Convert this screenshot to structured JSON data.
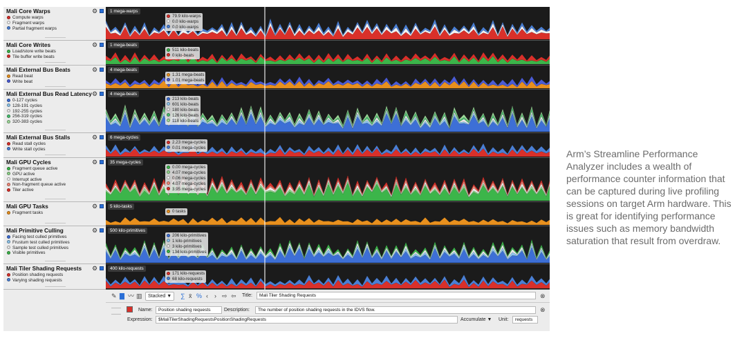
{
  "caption": "Arm’s Streamline Performance Analyzer includes a wealth of performance counter information that can be captured during live profiling sessions on target Arm hardware. This is great for identifying performance issues such as memory bandwidth saturation that result from overdraw.",
  "tracks": [
    {
      "title": "Mali Core Warps",
      "scale": "1 mega-warps",
      "legend": [
        {
          "label": "Compute warps",
          "color": "#d9302a"
        },
        {
          "label": "Fragment warps",
          "color": "#f2f2f2"
        },
        {
          "label": "Partial fragment warps",
          "color": "#4a7fd4"
        }
      ],
      "tooltip": [
        {
          "value": "79.9 kilo-warps",
          "color": "#d9302a"
        },
        {
          "value": "0.0 kilo-warps",
          "color": "#f2f2f2"
        },
        {
          "value": "0.0 kilo-warps",
          "color": "#4a7fd4"
        }
      ]
    },
    {
      "title": "Mali Core Writes",
      "scale": "1 mega-beats",
      "legend": [
        {
          "label": "Load/store write beats",
          "color": "#3cb54a"
        },
        {
          "label": "Tile buffer write beats",
          "color": "#d9302a"
        }
      ],
      "tooltip": [
        {
          "value": "511 kilo-beats",
          "color": "#3cb54a"
        },
        {
          "value": "0 kilo-beats",
          "color": "#d9302a"
        }
      ]
    },
    {
      "title": "Mali External Bus Beats",
      "scale": "4 mega-beats",
      "legend": [
        {
          "label": "Read beat",
          "color": "#e8901e"
        },
        {
          "label": "Write beat",
          "color": "#4a5bd4"
        }
      ],
      "tooltip": [
        {
          "value": "1.31 mega-beats",
          "color": "#e8901e"
        },
        {
          "value": "1.01 mega-beats",
          "color": "#4a5bd4"
        }
      ]
    },
    {
      "title": "Mali External Bus Read Latency",
      "scale": "4 mega-beats",
      "legend": [
        {
          "label": "0-127 cycles",
          "color": "#3d6fd6"
        },
        {
          "label": "128-191 cycles",
          "color": "#8ec4ea"
        },
        {
          "label": "192-255 cycles",
          "color": "#e8e8e8"
        },
        {
          "label": "256-319 cycles",
          "color": "#4ac070"
        },
        {
          "label": "320-383 cycles",
          "color": "#9ed99a"
        }
      ],
      "tooltip": [
        {
          "value": "213 kilo-beats",
          "color": "#3d6fd6"
        },
        {
          "value": "601 kilo-beats",
          "color": "#8ec4ea"
        },
        {
          "value": "180 kilo-beats",
          "color": "#e8e8e8"
        },
        {
          "value": "126 kilo-beats",
          "color": "#4ac070"
        },
        {
          "value": "118 kilo-beats",
          "color": "#9ed99a"
        }
      ]
    },
    {
      "title": "Mali External Bus Stalls",
      "scale": "6 mega-cycles",
      "legend": [
        {
          "label": "Read stall cycles",
          "color": "#d9302a"
        },
        {
          "label": "Write stall cycles",
          "color": "#4a7fd4"
        }
      ],
      "tooltip": [
        {
          "value": "2.23 mega-cycles",
          "color": "#d9302a"
        },
        {
          "value": "0.01 mega-cycles",
          "color": "#4a7fd4"
        }
      ]
    },
    {
      "title": "Mali GPU Cycles",
      "scale": "35 mega-cycles",
      "legend": [
        {
          "label": "Fragment queue active",
          "color": "#3cb54a"
        },
        {
          "label": "GPU active",
          "color": "#8fd28a"
        },
        {
          "label": "Interrupt active",
          "color": "#f0f0f0"
        },
        {
          "label": "Non-fragment queue active",
          "color": "#f08a7a"
        },
        {
          "label": "Tiler active",
          "color": "#d9302a"
        }
      ],
      "tooltip": [
        {
          "value": "0.00 mega-cycles",
          "color": "#3cb54a"
        },
        {
          "value": "4.07 mega-cycles",
          "color": "#8fd28a"
        },
        {
          "value": "0.06 mega-cycles",
          "color": "#f0f0f0"
        },
        {
          "value": "4.07 mega-cycles",
          "color": "#f08a7a"
        },
        {
          "value": "3.95 mega-cycles",
          "color": "#d9302a"
        }
      ]
    },
    {
      "title": "Mali GPU Tasks",
      "scale": "5 kilo-tasks",
      "legend": [
        {
          "label": "Fragment tasks",
          "color": "#e8901e"
        }
      ],
      "tooltip": [
        {
          "value": "0 tasks",
          "color": "#e8901e"
        }
      ]
    },
    {
      "title": "Mali Primitive Culling",
      "scale": "500 kilo-primitives",
      "legend": [
        {
          "label": "Facing test culled primitives",
          "color": "#3d6fd6"
        },
        {
          "label": "Frustum test culled primitives",
          "color": "#8ec4ea"
        },
        {
          "label": "Sample test culled primitives",
          "color": "#e8e8e8"
        },
        {
          "label": "Visible primitives",
          "color": "#3cb54a"
        }
      ],
      "tooltip": [
        {
          "value": "206 kilo-primitives",
          "color": "#3d6fd6"
        },
        {
          "value": "1 kilo-primitives",
          "color": "#8ec4ea"
        },
        {
          "value": "3 kilo-primitives",
          "color": "#e8e8e8"
        },
        {
          "value": "134 kilo-primitives",
          "color": "#3cb54a"
        }
      ]
    },
    {
      "title": "Mali Tiler Shading Requests",
      "scale": "400 kilo-requests",
      "legend": [
        {
          "label": "Position shading requests",
          "color": "#d9302a"
        },
        {
          "label": "Varying shading requests",
          "color": "#4a7fd4"
        }
      ],
      "tooltip": [
        {
          "value": "171 kilo-requests",
          "color": "#d9302a"
        },
        {
          "value": "68 kilo-requests",
          "color": "#4a7fd4"
        }
      ]
    }
  ],
  "toolbar": {
    "mode": "Stacked",
    "title_label": "Title:",
    "title_value": "Mali Tiler Shading Requests"
  },
  "series_editor": {
    "name_label": "Name:",
    "name_value": "Position shading requests",
    "description_label": "Description:",
    "description_value": "The number of position shading requests in the IDVS flow.",
    "expression_label": "Expression:",
    "expression_value": "$MaliTilerShadingRequestsPositionShadingRequests",
    "accumulate_label": "Accumulate ▼",
    "unit_label": "Unit:",
    "unit_value": "requests",
    "swatch_color": "#d9302a"
  }
}
